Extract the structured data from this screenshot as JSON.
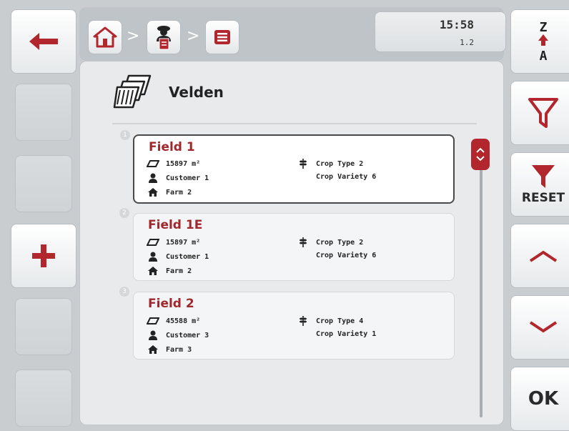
{
  "header": {
    "time": "15:58",
    "version": "1.2",
    "breadcrumb": [
      {
        "icon": "home-icon"
      },
      {
        "icon": "farmer-document-icon"
      },
      {
        "icon": "menu-icon"
      }
    ],
    "separator": ">"
  },
  "page": {
    "title": "Velden",
    "icon": "fields-icon"
  },
  "fields": [
    {
      "index": "1",
      "name": "Field 1",
      "area": "15897 m²",
      "customer": "Customer 1",
      "farm": "Farm 2",
      "crop_type": "Crop Type 2",
      "crop_variety": "Crop Variety 6",
      "selected": true
    },
    {
      "index": "2",
      "name": "Field 1E",
      "area": "15897 m²",
      "customer": "Customer 1",
      "farm": "Farm 2",
      "crop_type": "Crop Type 2",
      "crop_variety": "Crop Variety 6",
      "selected": false
    },
    {
      "index": "3",
      "name": "Field 2",
      "area": "45588 m²",
      "customer": "Customer 3",
      "farm": "Farm 3",
      "crop_type": "Crop Type 4",
      "crop_variety": "Crop Variety 1",
      "selected": false
    }
  ],
  "right_buttons": {
    "sort_top": "Z",
    "sort_bottom": "A",
    "reset_label": "RESET",
    "ok_label": "OK"
  },
  "colors": {
    "accent": "#b1272d",
    "field_name": "#a0282d"
  }
}
